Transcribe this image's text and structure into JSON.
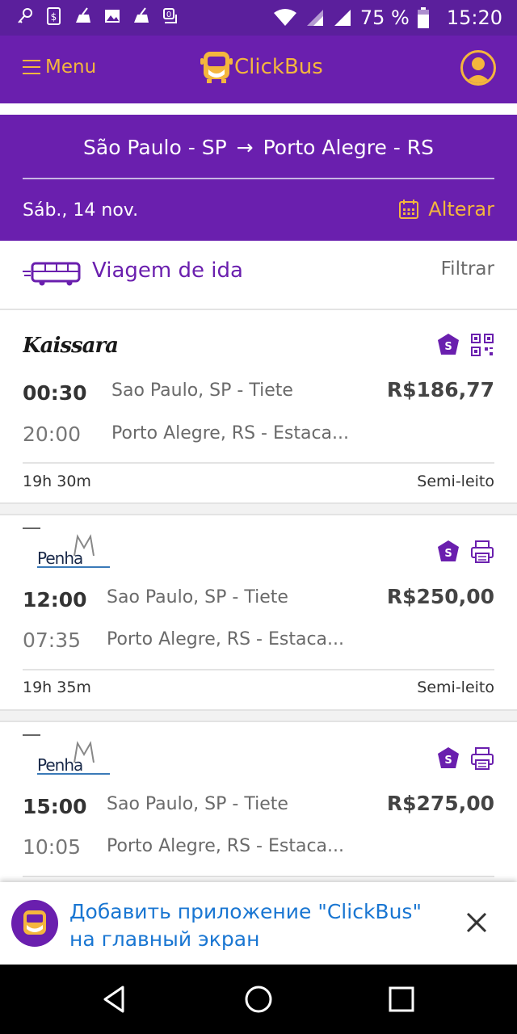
{
  "status_bar": {
    "icons": [
      "key-icon",
      "sim-alert-icon",
      "cleaner-icon",
      "image-icon",
      "cleaner-icon",
      "notification-icon"
    ],
    "battery": "75 %",
    "time": "15:20"
  },
  "header": {
    "menu_label": "Menu",
    "logo_text": "ClickBus"
  },
  "route": {
    "origin": "São Paulo - SP",
    "arrow": "→",
    "destination": "Porto Alegre - RS",
    "date": "Sáb., 14 nov.",
    "change_label": "Alterar"
  },
  "trip": {
    "label": "Viagem de ida",
    "filter_label": "Filtrar"
  },
  "results": [
    {
      "company": "Kaissara",
      "badge": "S",
      "extra_icon": "qr-code-icon",
      "departure_time": "00:30",
      "departure_station": "Sao Paulo, SP - Tiete",
      "arrival_time": "20:00",
      "arrival_station": "Porto Alegre, RS - Estaca...",
      "price": "R$186,77",
      "duration": "19h 30m",
      "seat_class": "Semi-leito"
    },
    {
      "company": "Penha",
      "badge": "S",
      "extra_icon": "printer-icon",
      "departure_time": "12:00",
      "departure_station": "Sao Paulo, SP - Tiete",
      "arrival_time": "07:35",
      "arrival_station": "Porto Alegre, RS - Estaca...",
      "price": "R$250,00",
      "duration": "19h 35m",
      "seat_class": "Semi-leito"
    },
    {
      "company": "Penha",
      "badge": "S",
      "extra_icon": "printer-icon",
      "departure_time": "15:00",
      "departure_station": "Sao Paulo, SP - Tiete",
      "arrival_time": "10:05",
      "arrival_station": "Porto Alegre, RS - Estaca...",
      "price": "R$275,00"
    }
  ],
  "install_banner": {
    "text": "Добавить приложение \"ClickBus\" на главный экран"
  },
  "colors": {
    "brand_purple": "#6a1fae",
    "accent_yellow": "#f4b63d",
    "banner_blue": "#1976d2"
  }
}
